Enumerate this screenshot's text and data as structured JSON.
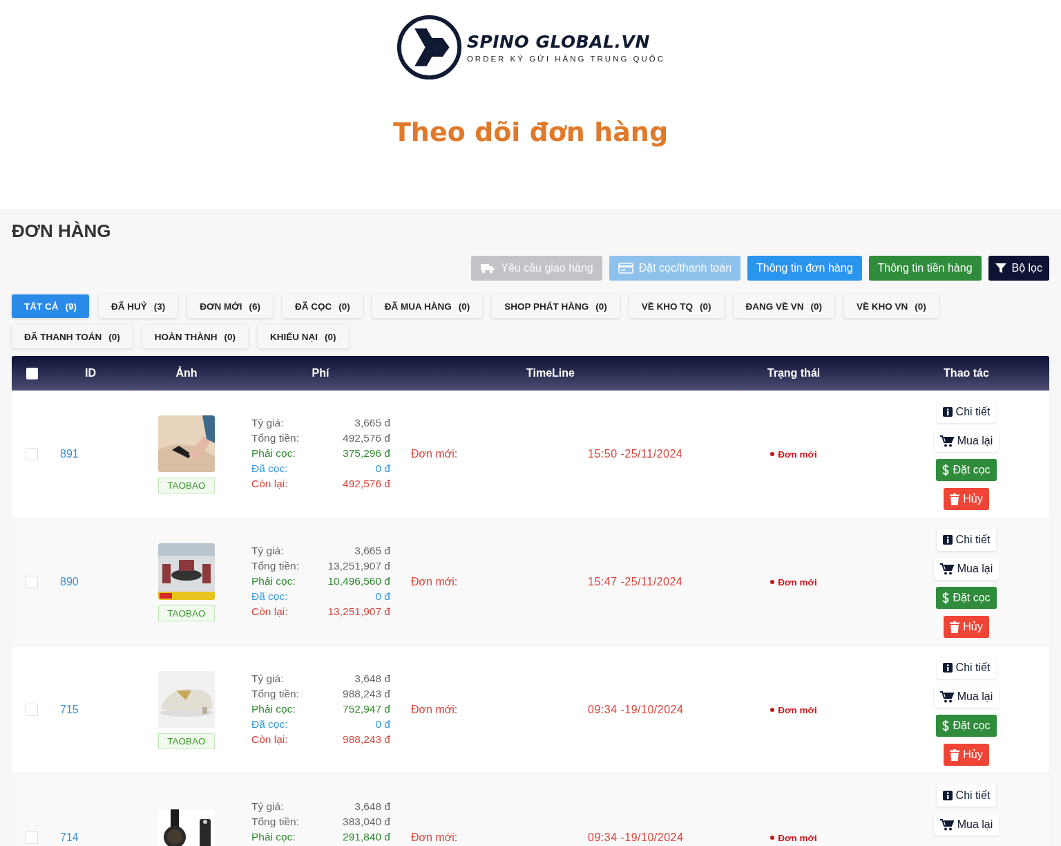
{
  "brand": {
    "name": "SPINO GLOBAL.VN",
    "tagline": "ORDER KÝ GỬI HÀNG TRUNG QUỐC"
  },
  "page_title": "Theo dõi đơn hàng",
  "section_title": "ĐƠN HÀNG",
  "toolbar": [
    {
      "label": "Yêu cầu giao hàng",
      "kind": "delivery",
      "disabled": true
    },
    {
      "label": "Đặt cọc/thanh toán",
      "kind": "payment",
      "disabled": true
    },
    {
      "label": "Thông tin đơn hàng",
      "kind": "order-info",
      "disabled": false
    },
    {
      "label": "Thông tin tiền hàng",
      "kind": "money-info",
      "disabled": false
    },
    {
      "label": "Bộ lọc",
      "kind": "filter",
      "disabled": false
    }
  ],
  "tabs": [
    {
      "label": "TẤT CẢ",
      "count": "(9)",
      "selected": true
    },
    {
      "label": "ĐÃ HUỶ",
      "count": "(3)",
      "selected": false
    },
    {
      "label": "ĐƠN MỚI",
      "count": "(6)",
      "selected": false
    },
    {
      "label": "ĐÃ CỌC",
      "count": "(0)",
      "selected": false
    },
    {
      "label": "ĐÃ MUA HÀNG",
      "count": "(0)",
      "selected": false
    },
    {
      "label": "SHOP PHÁT HÀNG",
      "count": "(0)",
      "selected": false
    },
    {
      "label": "VỀ KHO TQ",
      "count": "(0)",
      "selected": false
    },
    {
      "label": "ĐANG VỀ VN",
      "count": "(0)",
      "selected": false
    },
    {
      "label": "VỀ KHO VN",
      "count": "(0)",
      "selected": false
    },
    {
      "label": "ĐÃ THANH TOÁN",
      "count": "(0)",
      "selected": false
    },
    {
      "label": "HOÀN THÀNH",
      "count": "(0)",
      "selected": false
    },
    {
      "label": "KHIẾU NẠI",
      "count": "(0)",
      "selected": false
    }
  ],
  "table": {
    "select_all_checked": false,
    "columns": [
      "ID",
      "Ảnh",
      "Phí",
      "TimeLine",
      "Trạng thái",
      "Thao tác"
    ],
    "rows": [
      {
        "checked": false,
        "id": "891",
        "source": "TAOBAO",
        "fees": [
          {
            "kind": "rate",
            "label": "Tỷ giá:",
            "value": "3,665 đ"
          },
          {
            "kind": "total",
            "label": "Tổng tiền:",
            "value": "492,576 đ"
          },
          {
            "kind": "required",
            "label": "Phải cọc:",
            "value": "375,296 đ"
          },
          {
            "kind": "paid",
            "label": "Đã cọc:",
            "value": "0 đ"
          },
          {
            "kind": "remaining",
            "label": "Còn lại:",
            "value": "492,576 đ"
          }
        ],
        "timeline": {
          "label": "Đơn mới:",
          "time": "15:50 -25/11/2024"
        },
        "status": "Đơn mới",
        "actions": [
          {
            "kind": "detail",
            "label": "Chi tiết"
          },
          {
            "kind": "rebuy",
            "label": "Mua lại"
          },
          {
            "kind": "deposit",
            "label": "Đặt cọc"
          },
          {
            "kind": "cancel",
            "label": "Hủy"
          }
        ]
      },
      {
        "checked": false,
        "id": "890",
        "source": "TAOBAO",
        "fees": [
          {
            "kind": "rate",
            "label": "Tỷ giá:",
            "value": "3,665 đ"
          },
          {
            "kind": "total",
            "label": "Tổng tiền:",
            "value": "13,251,907 đ"
          },
          {
            "kind": "required",
            "label": "Phải cọc:",
            "value": "10,496,560 đ"
          },
          {
            "kind": "paid",
            "label": "Đã cọc:",
            "value": "0 đ"
          },
          {
            "kind": "remaining",
            "label": "Còn lại:",
            "value": "13,251,907 đ"
          }
        ],
        "timeline": {
          "label": "Đơn mới:",
          "time": "15:47 -25/11/2024"
        },
        "status": "Đơn mới",
        "actions": [
          {
            "kind": "detail",
            "label": "Chi tiết"
          },
          {
            "kind": "rebuy",
            "label": "Mua lại"
          },
          {
            "kind": "deposit",
            "label": "Đặt cọc"
          },
          {
            "kind": "cancel",
            "label": "Hủy"
          }
        ]
      },
      {
        "checked": false,
        "id": "715",
        "source": "TAOBAO",
        "fees": [
          {
            "kind": "rate",
            "label": "Tỷ giá:",
            "value": "3,648 đ"
          },
          {
            "kind": "total",
            "label": "Tổng tiền:",
            "value": "988,243 đ"
          },
          {
            "kind": "required",
            "label": "Phải cọc:",
            "value": "752,947 đ"
          },
          {
            "kind": "paid",
            "label": "Đã cọc:",
            "value": "0 đ"
          },
          {
            "kind": "remaining",
            "label": "Còn lại:",
            "value": "988,243 đ"
          }
        ],
        "timeline": {
          "label": "Đơn mới:",
          "time": "09:34 -19/10/2024"
        },
        "status": "Đơn mới",
        "actions": [
          {
            "kind": "detail",
            "label": "Chi tiết"
          },
          {
            "kind": "rebuy",
            "label": "Mua lại"
          },
          {
            "kind": "deposit",
            "label": "Đặt cọc"
          },
          {
            "kind": "cancel",
            "label": "Hủy"
          }
        ]
      },
      {
        "checked": false,
        "id": "714",
        "fees": [
          {
            "kind": "rate",
            "label": "Tỷ giá:",
            "value": "3,648 đ"
          },
          {
            "kind": "total",
            "label": "Tổng tiền:",
            "value": "383,040 đ"
          },
          {
            "kind": "required",
            "label": "Phải cọc:",
            "value": "291,840 đ"
          }
        ],
        "timeline": {
          "label": "Đơn mới:",
          "time": "09:34 -19/10/2024"
        },
        "status": "Đơn mới",
        "actions": [
          {
            "kind": "detail",
            "label": "Chi tiết"
          },
          {
            "kind": "rebuy",
            "label": "Mua lại"
          }
        ]
      }
    ]
  }
}
